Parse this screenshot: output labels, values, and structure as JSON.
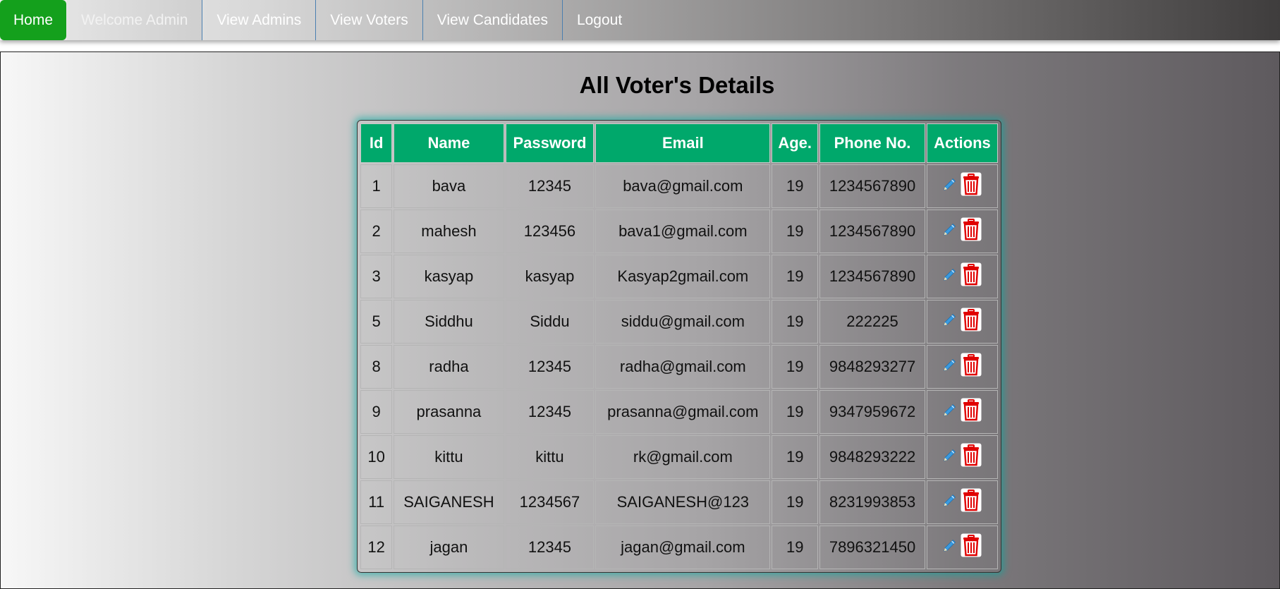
{
  "nav": {
    "home": "Home",
    "welcome": "Welcome Admin",
    "view_admins": "View Admins",
    "view_voters": "View Voters",
    "view_candidates": "View Candidates",
    "logout": "Logout"
  },
  "page": {
    "title": "All Voter's Details"
  },
  "table": {
    "headers": [
      "Id",
      "Name",
      "Password",
      "Email",
      "Age.",
      "Phone No.",
      "Actions"
    ],
    "rows": [
      [
        "1",
        "bava",
        "12345",
        "bava@gmail.com",
        "19",
        "1234567890"
      ],
      [
        "2",
        "mahesh",
        "123456",
        "bava1@gmail.com",
        "19",
        "1234567890"
      ],
      [
        "3",
        "kasyap",
        "kasyap",
        "Kasyap2gmail.com",
        "19",
        "1234567890"
      ],
      [
        "5",
        "Siddhu",
        "Siddu",
        "siddu@gmail.com",
        "19",
        "222225"
      ],
      [
        "8",
        "radha",
        "12345",
        "radha@gmail.com",
        "19",
        "9848293277"
      ],
      [
        "9",
        "prasanna",
        "12345",
        "prasanna@gmail.com",
        "19",
        "9347959672"
      ],
      [
        "10",
        "kittu",
        "kittu",
        "rk@gmail.com",
        "19",
        "9848293222"
      ],
      [
        "11",
        "SAIGANESH",
        "1234567",
        "SAIGANESH@123",
        "19",
        "8231993853"
      ],
      [
        "12",
        "jagan",
        "12345",
        "jagan@gmail.com",
        "19",
        "7896321450"
      ]
    ],
    "action_icons": [
      "edit-icon",
      "trash-icon"
    ]
  },
  "colors": {
    "home_bg": "#14a01c",
    "header_bg": "#00a86b",
    "edit_icon": "#2a8fd6",
    "trash_icon": "#e00000"
  }
}
